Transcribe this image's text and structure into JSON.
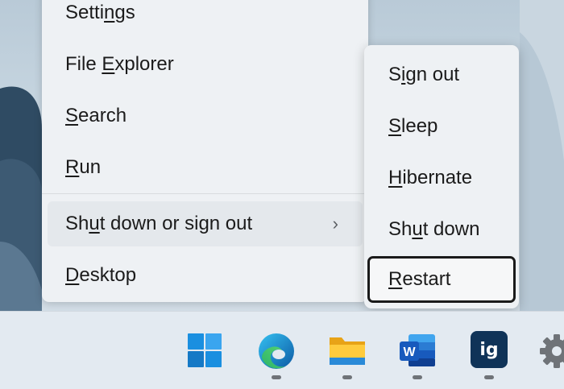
{
  "context_menu": {
    "items": [
      {
        "pre": "Setti",
        "key": "n",
        "post": "gs"
      },
      {
        "pre": "File ",
        "key": "E",
        "post": "xplorer"
      },
      {
        "pre": "",
        "key": "S",
        "post": "earch"
      },
      {
        "pre": "",
        "key": "R",
        "post": "un"
      }
    ],
    "shutdown": {
      "pre": "Sh",
      "key": "u",
      "post": "t down or sign out"
    },
    "desktop": {
      "pre": "",
      "key": "D",
      "post": "esktop"
    }
  },
  "submenu": {
    "items": [
      {
        "pre": "S",
        "key": "i",
        "post": "gn out"
      },
      {
        "pre": "",
        "key": "S",
        "post": "leep"
      },
      {
        "pre": "",
        "key": "H",
        "post": "ibernate"
      },
      {
        "pre": "Sh",
        "key": "u",
        "post": "t down"
      },
      {
        "pre": "",
        "key": "R",
        "post": "estart"
      }
    ]
  },
  "taskbar": {
    "icons": [
      {
        "name": "windows-start-icon",
        "running": false
      },
      {
        "name": "edge-browser-icon",
        "running": true
      },
      {
        "name": "file-explorer-icon",
        "running": true
      },
      {
        "name": "word-icon",
        "running": true
      },
      {
        "name": "ig-app-icon",
        "running": true
      },
      {
        "name": "settings-gear-icon",
        "running": false
      }
    ],
    "word_letter": "W",
    "ig_text": "ig"
  },
  "colors": {
    "menu_bg": "#eef1f4",
    "taskbar_bg": "#e3eaf1",
    "start_blue": "#1a8fe0",
    "word_blue": "#185abd",
    "ig_navy": "#0f3358"
  }
}
